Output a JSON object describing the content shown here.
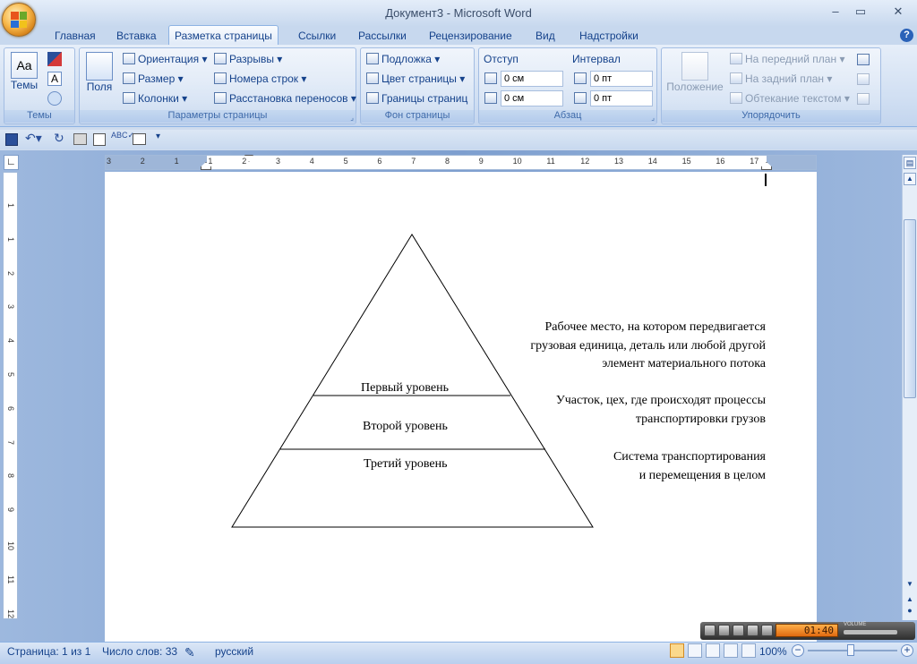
{
  "window": {
    "title": "Документ3 - Microsoft Word",
    "buttons": {
      "minimize": "–",
      "maximize": "▭",
      "close": "✕"
    }
  },
  "tabs": [
    "Главная",
    "Вставка",
    "Разметка страницы",
    "Ссылки",
    "Рассылки",
    "Рецензирование",
    "Вид",
    "Надстройки"
  ],
  "active_tab": "Разметка страницы",
  "help_icon": "?",
  "ribbon": {
    "themes": {
      "label": "Темы",
      "button": "Темы"
    },
    "page_setup": {
      "label": "Параметры страницы",
      "fields_button": "Поля",
      "orientation": "Ориентация",
      "size": "Размер",
      "columns": "Колонки",
      "breaks": "Разрывы",
      "line_numbers": "Номера строк",
      "hyphenation": "Расстановка переносов"
    },
    "page_background": {
      "label": "Фон страницы",
      "watermark": "Подложка",
      "page_color": "Цвет страницы",
      "page_borders": "Границы страниц"
    },
    "paragraph": {
      "label": "Абзац",
      "indent_title": "Отступ",
      "spacing_title": "Интервал",
      "indent_left": "0 см",
      "indent_right": "0 см",
      "spacing_before": "0 пт",
      "spacing_after": "0 пт"
    },
    "arrange": {
      "label": "Упорядочить",
      "position": "Положение",
      "bring_front": "На передний план",
      "send_back": "На задний план",
      "text_wrap": "Обтекание текстом"
    }
  },
  "ruler": {
    "h_ticks": [
      "3",
      "2",
      "1",
      "1",
      "2",
      "3",
      "4",
      "5",
      "6",
      "7",
      "8",
      "9",
      "10",
      "11",
      "12",
      "13",
      "14",
      "15",
      "16",
      "17"
    ],
    "v_ticks": [
      "1",
      "1",
      "2",
      "3",
      "4",
      "5",
      "6",
      "7",
      "8",
      "9",
      "10",
      "11",
      "12",
      "13"
    ]
  },
  "document": {
    "levels": [
      "Первый уровень",
      "Второй уровень",
      "Третий уровень"
    ],
    "annotations": [
      [
        "Рабочее место, на котором передвигается",
        "грузовая единица, деталь или любой другой",
        "элемент материального потока"
      ],
      [
        "Участок, цех, где происходят процессы",
        "транспортировки грузов"
      ],
      [
        "Система транспортирования",
        "и перемещения в целом"
      ]
    ]
  },
  "player": {
    "time": "01:40",
    "volume_label": "VOLUME"
  },
  "status": {
    "page": "Страница: 1 из 1",
    "words": "Число слов: 33",
    "language": "русский",
    "zoom": "100%"
  }
}
